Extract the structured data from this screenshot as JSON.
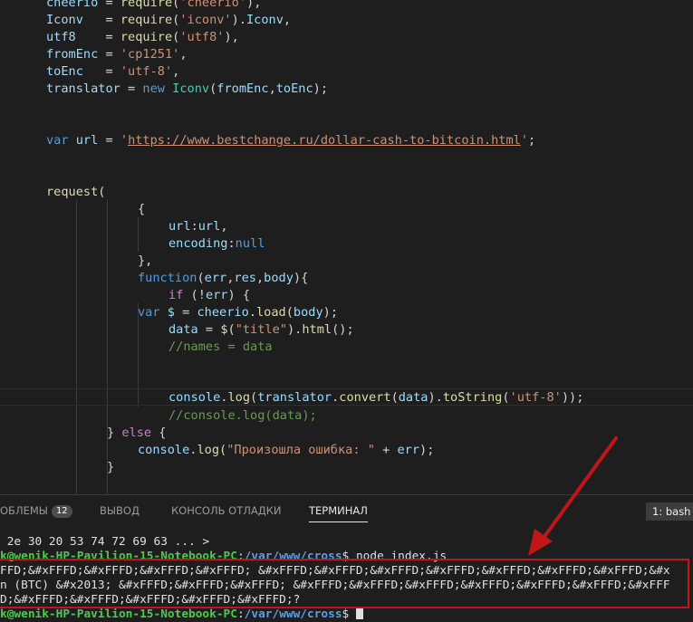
{
  "editor": {
    "lines": [
      [
        [
          "t-var",
          "cheerio"
        ],
        [
          "t-plain",
          " = "
        ],
        [
          "t-fn",
          "require"
        ],
        [
          "t-plain",
          "("
        ],
        [
          "t-str",
          "'cheerio'"
        ],
        [
          "t-plain",
          "),"
        ]
      ],
      [
        [
          "t-var",
          "Iconv"
        ],
        [
          "t-plain",
          "   = "
        ],
        [
          "t-fn",
          "require"
        ],
        [
          "t-plain",
          "("
        ],
        [
          "t-str",
          "'iconv'"
        ],
        [
          "t-plain",
          ")."
        ],
        [
          "t-var",
          "Iconv"
        ],
        [
          "t-plain",
          ","
        ]
      ],
      [
        [
          "t-var",
          "utf8"
        ],
        [
          "t-plain",
          "    = "
        ],
        [
          "t-fn",
          "require"
        ],
        [
          "t-plain",
          "("
        ],
        [
          "t-str",
          "'utf8'"
        ],
        [
          "t-plain",
          "),"
        ]
      ],
      [
        [
          "t-var",
          "fromEnc"
        ],
        [
          "t-plain",
          " = "
        ],
        [
          "t-str",
          "'cp1251'"
        ],
        [
          "t-plain",
          ","
        ]
      ],
      [
        [
          "t-var",
          "toEnc"
        ],
        [
          "t-plain",
          "   = "
        ],
        [
          "t-str",
          "'utf-8'"
        ],
        [
          "t-plain",
          ","
        ]
      ],
      [
        [
          "t-var",
          "translator"
        ],
        [
          "t-plain",
          " = "
        ],
        [
          "t-kw",
          "new"
        ],
        [
          "t-plain",
          " "
        ],
        [
          "t-cls",
          "Iconv"
        ],
        [
          "t-plain",
          "("
        ],
        [
          "t-var",
          "fromEnc"
        ],
        [
          "t-plain",
          ","
        ],
        [
          "t-var",
          "toEnc"
        ],
        [
          "t-plain",
          ");"
        ]
      ],
      [],
      [],
      [
        [
          "t-kw",
          "var"
        ],
        [
          "t-plain",
          " "
        ],
        [
          "t-var",
          "url"
        ],
        [
          "t-plain",
          " = "
        ],
        [
          "t-str",
          "'"
        ],
        [
          "t-url",
          "https://www.bestchange.ru/dollar-cash-to-bitcoin.html"
        ],
        [
          "t-str",
          "'"
        ],
        [
          "t-plain",
          ";"
        ]
      ],
      [],
      [],
      [
        [
          "t-fn",
          "request"
        ],
        [
          "t-plain",
          "("
        ]
      ],
      [
        [
          "t-plain",
          "{"
        ]
      ],
      [
        [
          "t-var",
          "url"
        ],
        [
          "t-plain",
          ":"
        ],
        [
          "t-var",
          "url"
        ],
        [
          "t-plain",
          ","
        ]
      ],
      [
        [
          "t-var",
          "encoding"
        ],
        [
          "t-plain",
          ":"
        ],
        [
          "t-kw",
          "null"
        ]
      ],
      [
        [
          "t-plain",
          "},"
        ]
      ],
      [
        [
          "t-kw",
          "function"
        ],
        [
          "t-plain",
          "("
        ],
        [
          "t-var",
          "err"
        ],
        [
          "t-plain",
          ","
        ],
        [
          "t-var",
          "res"
        ],
        [
          "t-plain",
          ","
        ],
        [
          "t-var",
          "body"
        ],
        [
          "t-plain",
          "){"
        ]
      ],
      [
        [
          "t-ctl",
          "if"
        ],
        [
          "t-plain",
          " (!"
        ],
        [
          "t-var",
          "err"
        ],
        [
          "t-plain",
          ") {"
        ]
      ],
      [
        [
          "t-kw",
          "var"
        ],
        [
          "t-plain",
          " "
        ],
        [
          "t-var",
          "$"
        ],
        [
          "t-plain",
          " = "
        ],
        [
          "t-var",
          "cheerio"
        ],
        [
          "t-plain",
          "."
        ],
        [
          "t-fn",
          "load"
        ],
        [
          "t-plain",
          "("
        ],
        [
          "t-var",
          "body"
        ],
        [
          "t-plain",
          ");"
        ]
      ],
      [
        [
          "t-var",
          "data"
        ],
        [
          "t-plain",
          " = "
        ],
        [
          "t-fn",
          "$"
        ],
        [
          "t-plain",
          "("
        ],
        [
          "t-str",
          "\"title\""
        ],
        [
          "t-plain",
          ")."
        ],
        [
          "t-fn",
          "html"
        ],
        [
          "t-plain",
          "();"
        ]
      ],
      [
        [
          "t-com",
          "//names = data"
        ]
      ],
      [],
      [],
      [
        [
          "t-var",
          "console"
        ],
        [
          "t-plain",
          "."
        ],
        [
          "t-fn",
          "log"
        ],
        [
          "t-plain",
          "("
        ],
        [
          "t-var",
          "translator"
        ],
        [
          "t-plain",
          "."
        ],
        [
          "t-fn",
          "convert"
        ],
        [
          "t-plain",
          "("
        ],
        [
          "t-var",
          "data"
        ],
        [
          "t-plain",
          ")."
        ],
        [
          "t-fn",
          "toString"
        ],
        [
          "t-plain",
          "("
        ],
        [
          "t-str",
          "'utf-8'"
        ],
        [
          "t-plain",
          "));"
        ]
      ],
      [
        [
          "t-com",
          "//console.log(data);"
        ]
      ],
      [
        [
          "t-plain",
          "} "
        ],
        [
          "t-ctl",
          "else"
        ],
        [
          "t-plain",
          " {"
        ]
      ],
      [
        [
          "t-var",
          "console"
        ],
        [
          "t-plain",
          "."
        ],
        [
          "t-fn",
          "log"
        ],
        [
          "t-plain",
          "("
        ],
        [
          "t-str",
          "\"Произошла ошибка: \""
        ],
        [
          "t-plain",
          " + "
        ],
        [
          "t-var",
          "err"
        ],
        [
          "t-plain",
          ");"
        ]
      ],
      [
        [
          "t-plain",
          "}"
        ]
      ]
    ]
  },
  "panel": {
    "tabs": [
      {
        "label": "ОБЛЕМЫ"
      },
      {
        "label": "ВЫВОД"
      },
      {
        "label": "КОНСОЛЬ ОТЛАДКИ"
      },
      {
        "label": "ТЕРМИНАЛ"
      }
    ],
    "problems_count": "12",
    "terminal_select": "1: bash"
  },
  "terminal": {
    "line1": " 2e 30 20 53 74 72 69 63 ... >",
    "prompt_user": "k@wenik-HP-Pavilion-15-Notebook-PC",
    "prompt_sep": ":",
    "prompt_path": "/var/www/cross",
    "prompt_cmd": "$ node index.js",
    "out1": "FFD;&#xFFFD;&#xFFFD;&#xFFFD;&#xFFFD; &#xFFFD;&#xFFFD;&#xFFFD;&#xFFFD;&#xFFFD;&#xFFFD;&#xFFFD;&#x",
    "out2": "n (BTC) &#x2013; &#xFFFD;&#xFFFD;&#xFFFD; &#xFFFD;&#xFFFD;&#xFFFD;&#xFFFD;&#xFFFD;&#xFFFD;&#xFFF",
    "out3": "D;&#xFFFD;&#xFFFD;&#xFFFD;&#xFFFD;&#xFFFD;?",
    "prompt2_user": "k@wenik-HP-Pavilion-15-Notebook-PC",
    "prompt2_sep": ":",
    "prompt2_path": "/var/www/cross",
    "prompt2_cmd": "$ "
  },
  "colors": {
    "annotation_red": "#c0161a",
    "background": "#1e1e1e"
  }
}
